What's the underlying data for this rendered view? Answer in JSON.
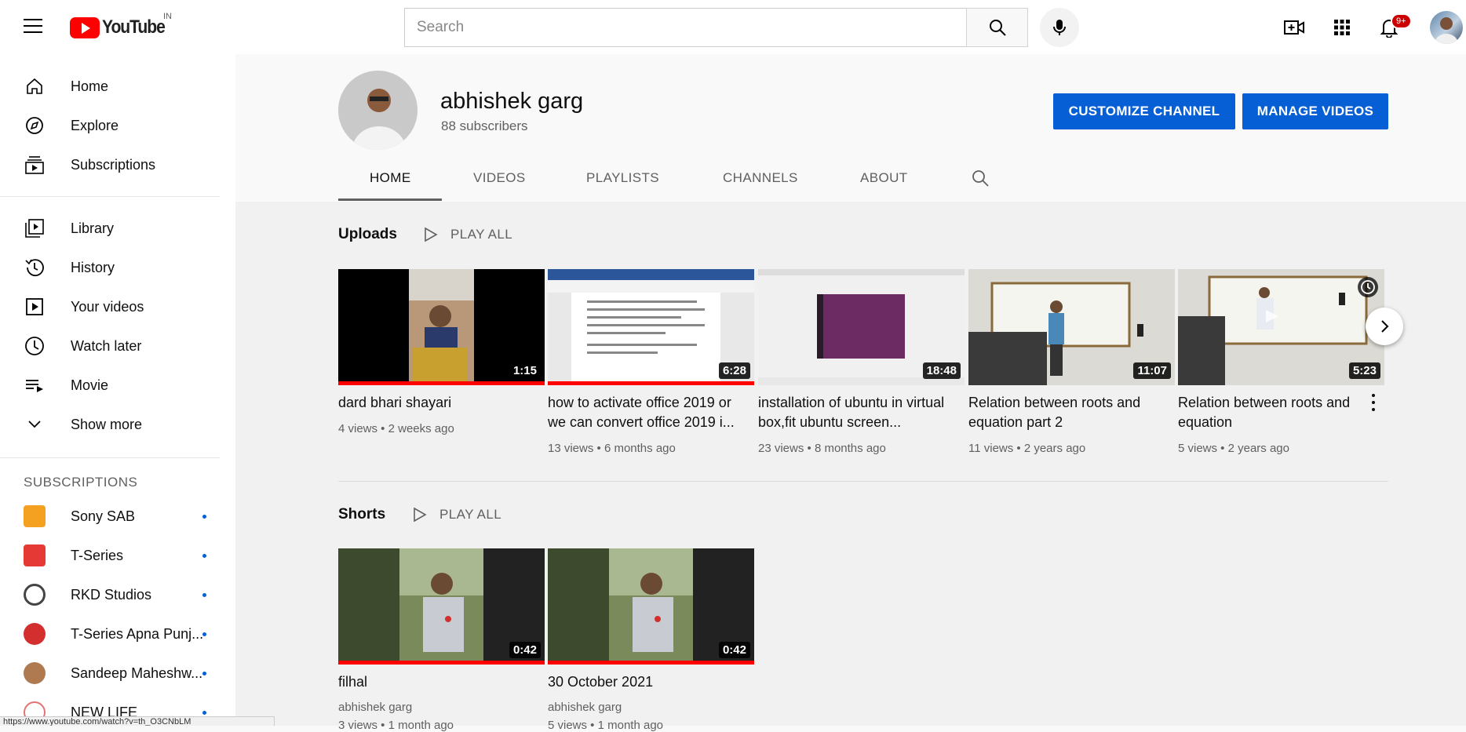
{
  "header": {
    "logo_text": "YouTube",
    "country_code": "IN",
    "search_placeholder": "Search",
    "notification_count": "9+"
  },
  "sidebar": {
    "main_items": [
      {
        "label": "Home",
        "icon": "home-icon"
      },
      {
        "label": "Explore",
        "icon": "compass-icon"
      },
      {
        "label": "Subscriptions",
        "icon": "subscriptions-icon"
      }
    ],
    "library_items": [
      {
        "label": "Library",
        "icon": "library-icon"
      },
      {
        "label": "History",
        "icon": "history-icon"
      },
      {
        "label": "Your videos",
        "icon": "your-videos-icon"
      },
      {
        "label": "Watch later",
        "icon": "clock-icon"
      },
      {
        "label": "Movie",
        "icon": "playlist-icon"
      },
      {
        "label": "Show more",
        "icon": "chevron-down-icon"
      }
    ],
    "subscriptions_heading": "SUBSCRIPTIONS",
    "subscriptions": [
      {
        "label": "Sony SAB",
        "color": "#f4a020"
      },
      {
        "label": "T-Series",
        "color": "#e53935"
      },
      {
        "label": "RKD Studios",
        "color": "#444444"
      },
      {
        "label": "T-Series Apna Punj...",
        "color": "#d32f2f"
      },
      {
        "label": "Sandeep Maheshw...",
        "color": "#b07a50"
      },
      {
        "label": "NEW LIFE",
        "color": "#e57373"
      }
    ]
  },
  "channel": {
    "name": "abhishek garg",
    "subscribers": "88 subscribers",
    "customize_label": "CUSTOMIZE CHANNEL",
    "manage_label": "MANAGE VIDEOS",
    "tabs": [
      "HOME",
      "VIDEOS",
      "PLAYLISTS",
      "CHANNELS",
      "ABOUT"
    ]
  },
  "uploads": {
    "title": "Uploads",
    "play_all": "PLAY ALL",
    "videos": [
      {
        "title": "dard bhari shayari",
        "meta": "4 views • 2 weeks ago",
        "duration": "1:15"
      },
      {
        "title": "how to activate office 2019 or we can convert office 2019 i...",
        "meta": "13 views • 6 months ago",
        "duration": "6:28"
      },
      {
        "title": "installation of ubuntu in virtual box,fit ubuntu screen...",
        "meta": "23 views • 8 months ago",
        "duration": "18:48"
      },
      {
        "title": "Relation between roots and equation part 2",
        "meta": "11 views • 2 years ago",
        "duration": "11:07"
      },
      {
        "title": "Relation between roots and equation",
        "meta": "5 views • 2 years ago",
        "duration": "5:23"
      }
    ]
  },
  "shorts": {
    "title": "Shorts",
    "play_all": "PLAY ALL",
    "videos": [
      {
        "title": "filhal",
        "channel": "abhishek garg",
        "meta": "3 views • 1 month ago",
        "duration": "0:42"
      },
      {
        "title": "30 October 2021",
        "channel": "abhishek garg",
        "meta": "5 views • 1 month ago",
        "duration": "0:42"
      }
    ]
  },
  "status_url": "https://www.youtube.com/watch?v=th_O3CNbLM"
}
